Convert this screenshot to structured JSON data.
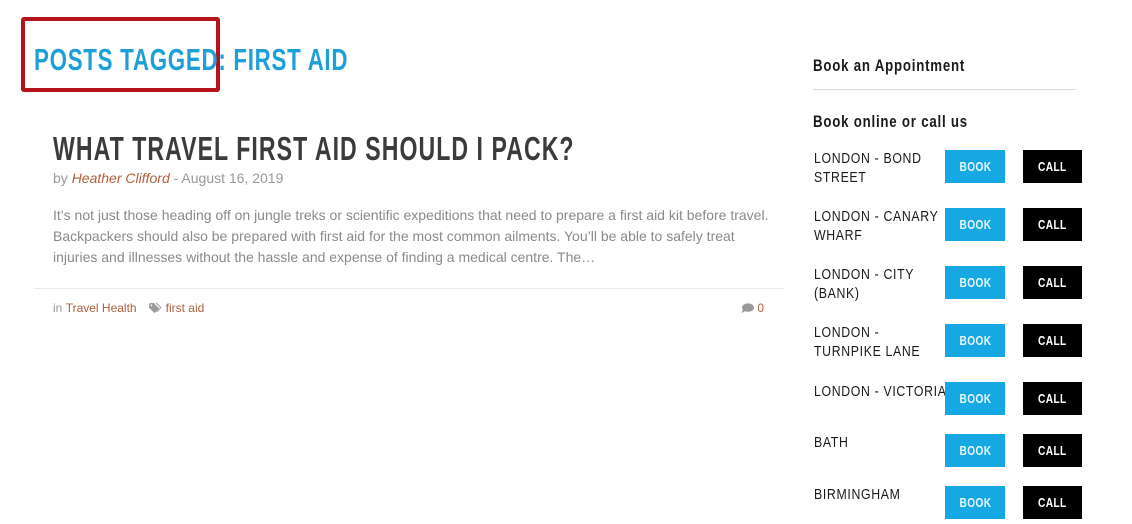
{
  "archive": {
    "prefix": "POSTS TAGGED:",
    "tag": "FIRST AID",
    "title_full": "POSTS TAGGED: FIRST AID"
  },
  "post": {
    "title": "WHAT TRAVEL FIRST AID SHOULD I PACK?",
    "meta_by": "by",
    "author": "Heather Clifford",
    "meta_sep": " - ",
    "date": "August 16, 2019",
    "excerpt": "It’s not just those heading off on jungle treks or scientific expeditions that need to prepare a first aid kit before travel. Backpackers should also be prepared with first aid for the most common ailments. You’ll be able to safely treat injuries and illnesses without the hassle and expense of finding a medical centre. The…",
    "footer": {
      "in_label": "in",
      "category": "Travel Health",
      "tag_icon": "tag-icon",
      "tag": "first aid",
      "comment_icon": "comment-icon",
      "comment_count": "0"
    }
  },
  "sidebar": {
    "widget_title": "Book an Appointment",
    "subtitle": "Book online or call us",
    "book_label": "BOOK",
    "call_label": "CALL",
    "colors": {
      "book": "#17a8e3",
      "call": "#000000",
      "accent": "#1d9fd8",
      "highlight": "#b5121b"
    },
    "locations": [
      {
        "name": "LONDON - BOND STREET"
      },
      {
        "name": "LONDON - CANARY WHARF"
      },
      {
        "name": "LONDON - CITY (BANK)"
      },
      {
        "name": "LONDON - TURNPIKE LANE"
      },
      {
        "name": "LONDON - VICTORIA"
      },
      {
        "name": "BATH"
      },
      {
        "name": "BIRMINGHAM"
      }
    ]
  }
}
